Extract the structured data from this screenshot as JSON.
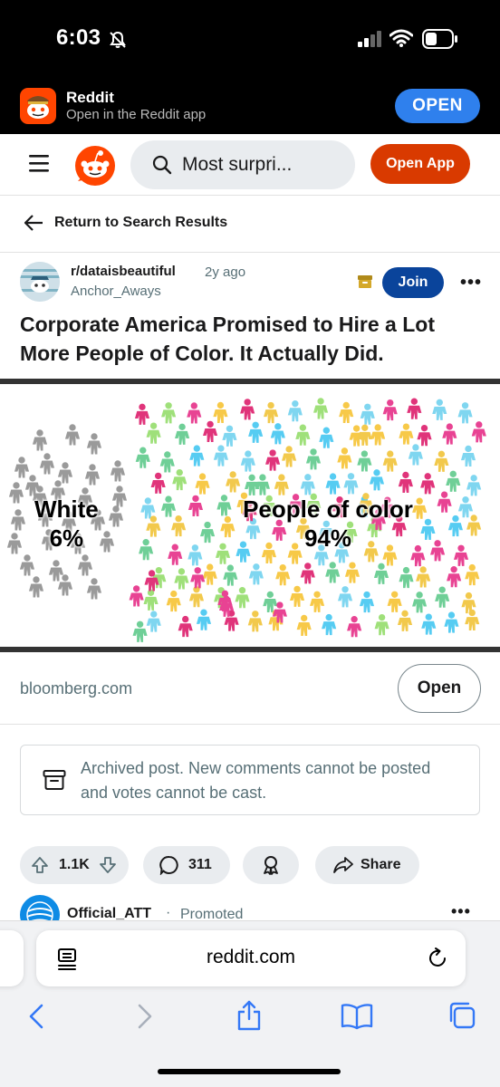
{
  "status_bar": {
    "time": "6:03"
  },
  "app_banner": {
    "app_name": "Reddit",
    "subtitle": "Open in the Reddit app",
    "open_label": "OPEN"
  },
  "header": {
    "search_text": "Most surpri...",
    "open_app_label": "Open App"
  },
  "return_row": {
    "label": "Return to Search Results"
  },
  "post": {
    "subreddit": "r/dataisbeautiful",
    "time_ago": "2y ago",
    "author": "Anchor_Aways",
    "join_label": "Join",
    "more_label": "•••",
    "title": "Corporate America Promised to Hire a Lot More People of Color. It Actually Did.",
    "image": {
      "white_label": "White",
      "white_value": "6%",
      "poc_label": "People of color",
      "poc_value": "94%"
    },
    "domain": "bloomberg.com",
    "open_link_label": "Open"
  },
  "archived_notice": {
    "text": "Archived post. New comments cannot be posted and votes cannot be cast."
  },
  "actions": {
    "votes": "1.1K",
    "comments": "311",
    "share_label": "Share"
  },
  "promoted": {
    "name": "Official_ATT",
    "separator": "·",
    "label": "Promoted",
    "more_label": "•••"
  },
  "browser": {
    "url": "reddit.com"
  },
  "colors": {
    "reddit_orange": "#ff4500",
    "open_app": "#d93a00",
    "join": "#0a449b",
    "banner_open": "#2f80ed",
    "ios_blue": "#3478f6"
  }
}
